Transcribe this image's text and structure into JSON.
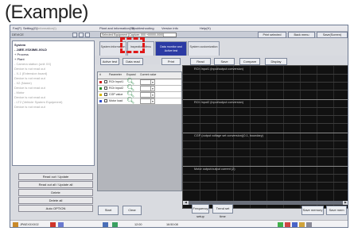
{
  "heading": "(Example)",
  "menubar": [
    "Far(F)",
    "Setting(G)",
    "Information(I)",
    "Help(H)",
    "Plant and information(W)",
    "Troubleshooting",
    "Version info",
    "Help(H)",
    "Help(H)",
    "Help(H)"
  ],
  "toolbar": {
    "title": "DEVICE",
    "view_label": "1 | 4"
  },
  "device_title": "Selected Equipment [Capture: 000 +00000-0000]",
  "top_buttons": [
    "Print selected",
    "Back menu",
    "Save(Screen)"
  ],
  "tree": [
    {
      "label": "System",
      "cls": "bold"
    },
    {
      "label": "- J4EE-VSX8M0-X0LD",
      "cls": "bold"
    },
    {
      "label": "+ Process",
      "cls": ""
    },
    {
      "label": "+ Plant",
      "cls": ""
    },
    {
      "label": "- Camera station (unit XX)",
      "cls": "dim"
    },
    {
      "label": "    Device is not read out",
      "cls": "dim"
    },
    {
      "label": "- X-1 (Extension board)",
      "cls": "dim"
    },
    {
      "label": "    Device is not read out",
      "cls": "dim"
    },
    {
      "label": "- X2 (Name)",
      "cls": "dim"
    },
    {
      "label": "    Device is not read out",
      "cls": "dim"
    },
    {
      "label": "- Motor",
      "cls": "dim"
    },
    {
      "label": "    Device is not read out",
      "cls": "dim"
    },
    {
      "label": "- LT2 (Vehicle System Equipment)",
      "cls": "dim"
    },
    {
      "label": "    Device is not read out",
      "cls": "dim"
    }
  ],
  "left_buttons": [
    "Read out / Update",
    "Read out all / Update all",
    "Delete",
    "Delete all",
    "Auto OPTION"
  ],
  "tabs": [
    {
      "label": "System information",
      "active": false
    },
    {
      "label": "Inspection Menu",
      "active": false
    },
    {
      "label": "Data monitor and Active test",
      "active": true
    },
    {
      "label": "System customization",
      "active": false
    }
  ],
  "sub_buttons": [
    "Active test",
    "Data read",
    "Print",
    "Read",
    "Save",
    "Compare",
    "Display"
  ],
  "param_head": [
    "#",
    "Parameter",
    "Expand",
    "Current value"
  ],
  "params": [
    {
      "name": "RCh Input1",
      "color": "#d11a1a"
    },
    {
      "name": "RCh Input2",
      "color": "#2a8a2a"
    },
    {
      "name": "CGP value",
      "color": "#d6b800"
    },
    {
      "name": "Motor load",
      "color": "#2a4ad0"
    }
  ],
  "graph_labels": [
    "RCh Input1 (input/output conversion)",
    "RCh Input2 (input/output conversion)",
    "CGP (output voltage set conversion)(0.1, boundary)",
    "Motor output/output current (2)"
  ],
  "bottom_buttons": [
    "Start",
    "Clear",
    "Frequency setup",
    "Trend set time",
    "Save memory",
    "Save mem"
  ],
  "taskbar": {
    "left": "JPAEXXXX02",
    "mid": "12:00",
    "right": "16:50:08"
  },
  "colors": {
    "accent": "#2b3aa4",
    "highlight": "#e01818",
    "graph_bg": "#111111"
  }
}
